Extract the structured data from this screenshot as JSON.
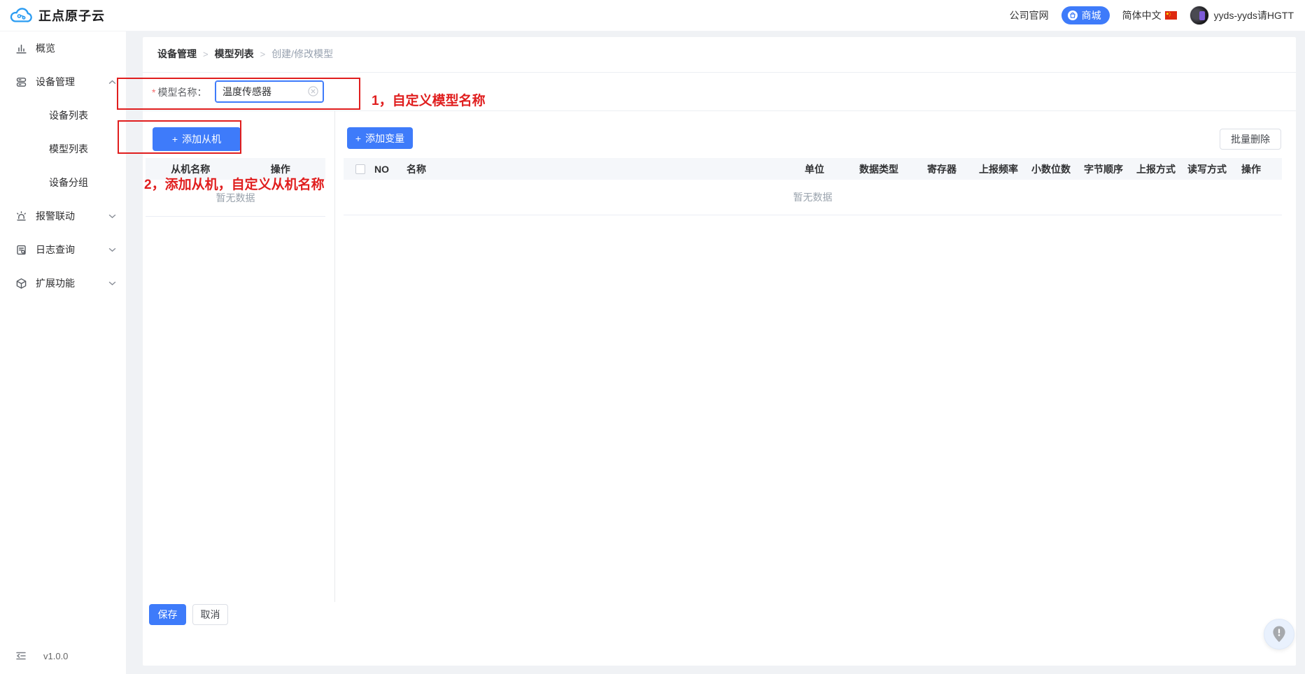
{
  "header": {
    "brand": "正点原子云",
    "official_site": "公司官网",
    "mall": "商城",
    "language": "简体中文",
    "username": "yyds-yyds请HGTT"
  },
  "sidebar": {
    "items": {
      "overview": "概览",
      "device_mgmt": "设备管理",
      "device_list": "设备列表",
      "model_list": "模型列表",
      "device_group": "设备分组",
      "alarm_link": "报警联动",
      "log_query": "日志查询",
      "extensions": "扩展功能"
    },
    "version": "v1.0.0"
  },
  "breadcrumb": {
    "items": [
      "设备管理",
      "模型列表",
      "创建/修改模型"
    ],
    "separator": ">"
  },
  "form": {
    "required_mark": "*",
    "model_name_label": "模型名称：",
    "model_name_value": "温度传感器"
  },
  "slave_panel": {
    "add_button": "添加从机",
    "plus": "+",
    "columns": [
      "从机名称",
      "操作"
    ],
    "empty": "暂无数据"
  },
  "variable_panel": {
    "add_button": "添加变量",
    "plus": "+",
    "batch_delete": "批量删除",
    "columns": [
      "NO",
      "名称",
      "单位",
      "数据类型",
      "寄存器",
      "上报频率",
      "小数位数",
      "字节顺序",
      "上报方式",
      "读写方式",
      "操作"
    ],
    "empty": "暂无数据"
  },
  "footer": {
    "save": "保存",
    "cancel": "取消"
  },
  "annotations": {
    "step1": "1，自定义模型名称",
    "step2": "2，添加从机，自定义从机名称"
  },
  "colors": {
    "primary_blue": "#3e7bfa",
    "annotation_red": "#e01e1e",
    "table_header_bg": "#f5f7fa",
    "page_bg": "#f0f2f5"
  }
}
